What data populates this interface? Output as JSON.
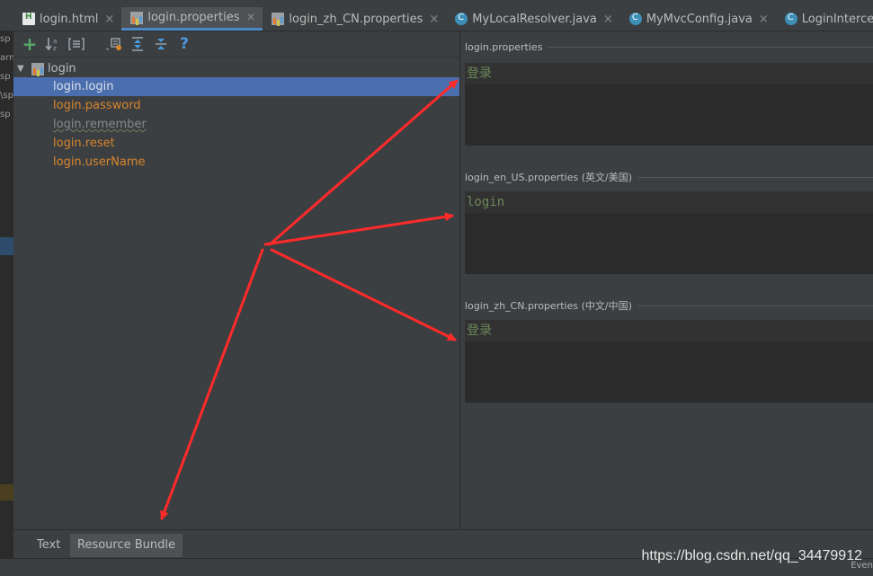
{
  "tabs": [
    {
      "label": "login.html",
      "icon": "html-file-icon",
      "active": false
    },
    {
      "label": "login.properties",
      "icon": "properties-file-icon",
      "active": true
    },
    {
      "label": "login_zh_CN.properties",
      "icon": "properties-file-icon",
      "active": false
    },
    {
      "label": "MyLocalResolver.java",
      "icon": "java-class-icon",
      "active": false
    },
    {
      "label": "MyMvcConfig.java",
      "icon": "java-class-icon",
      "active": false
    },
    {
      "label": "LoginInterceptor.java",
      "icon": "java-class-icon",
      "active": false
    }
  ],
  "close_glyph": "×",
  "toolbar": {
    "add": "+",
    "sort": "↓ᵃz",
    "help": "?"
  },
  "tree": {
    "root": "login",
    "items": [
      {
        "label": "login.login",
        "selected": true
      },
      {
        "label": "login.password"
      },
      {
        "label": "login.remember"
      },
      {
        "label": "login.reset"
      },
      {
        "label": "login.userName"
      }
    ]
  },
  "sections": [
    {
      "title": "login.properties",
      "value": "登录"
    },
    {
      "title": "login_en_US.properties (英文/美国)",
      "value": "login"
    },
    {
      "title": "login_zh_CN.properties (中文/中国)",
      "value": "登录"
    }
  ],
  "bottom_tabs": [
    {
      "label": "Text",
      "active": false
    },
    {
      "label": "Resource Bundle",
      "active": true
    }
  ],
  "watermark": "https://blog.csdn.net/qq_34479912",
  "status_event": "Even",
  "gutter_text": [
    "sp",
    "arn",
    "sp",
    "\\sp",
    "sp"
  ],
  "colors": {
    "selection": "#4b6eaf",
    "key_orange": "#d8852e",
    "value_green": "#6a8759",
    "arrow": "#ff2a2a"
  }
}
